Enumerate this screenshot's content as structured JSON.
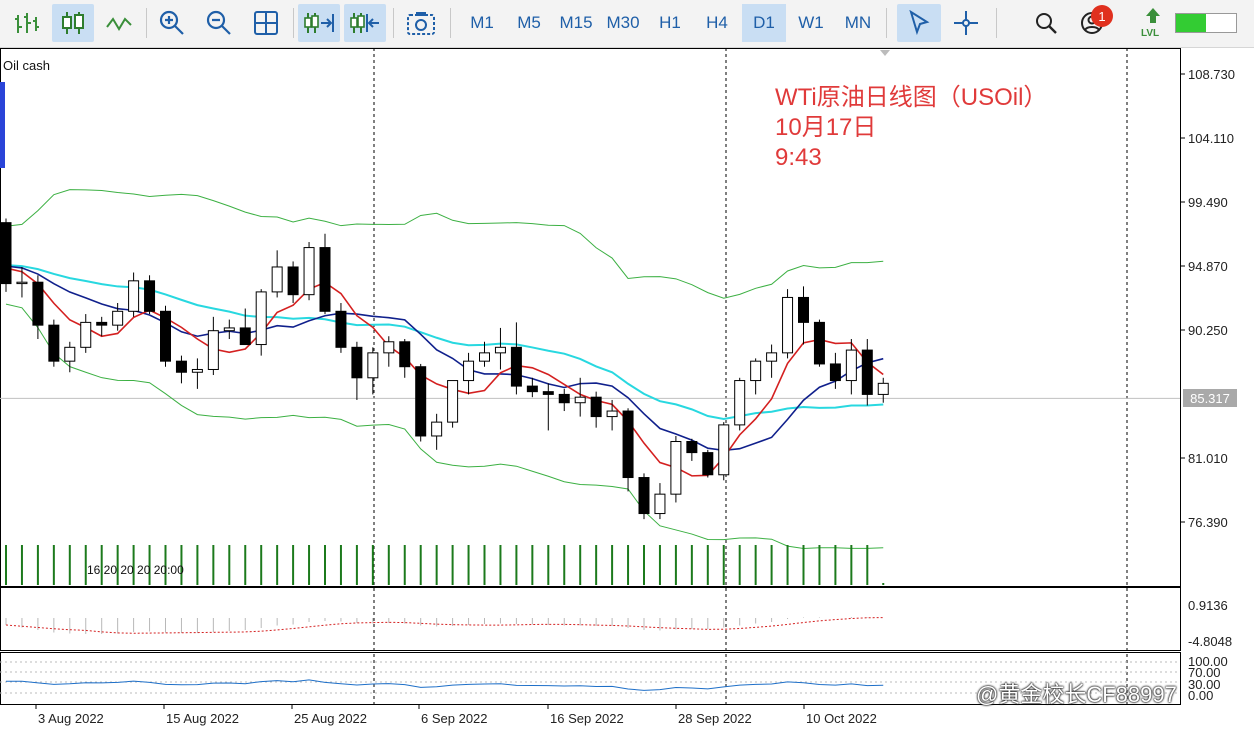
{
  "toolbar": {
    "timeframes": [
      "M1",
      "M5",
      "M15",
      "M30",
      "H1",
      "H4",
      "D1",
      "W1",
      "MN"
    ],
    "active_timeframe": "D1",
    "notification_count": "1",
    "lvl_label": "LVL"
  },
  "chart": {
    "symbol": "Oil cash",
    "annotation": [
      "WTi原油日线图（USOil）",
      "10月17日",
      "9:43"
    ],
    "current_price": "85.317",
    "price_ticks": [
      "108.730",
      "104.110",
      "99.490",
      "94.870",
      "90.250",
      "85.317",
      "81.010",
      "76.390"
    ],
    "macd_ticks": [
      "0.9136",
      "-4.8048"
    ],
    "rsi_ticks": [
      "100.00",
      "70.00",
      "30.00",
      "0.00"
    ],
    "date_labels": [
      "3 Aug 2022",
      "15 Aug 2022",
      "25 Aug 2022",
      "6 Sep 2022",
      "16 Sep 2022",
      "28 Sep 2022",
      "10 Oct 2022"
    ],
    "time_tags": "16 20 20 20 20:00",
    "watermark": "@黄金校长CF88997",
    "colors": {
      "bull": "#ffffff",
      "bear": "#000000",
      "ma_fast": "#d42020",
      "ma_mid": "#10208c",
      "ma_slow": "#28d8e0",
      "bands": "#3cb043",
      "volume": "#1c7a1c",
      "rsi": "#1e6fc8",
      "annotation": "#e03a3a"
    }
  },
  "chart_data": {
    "type": "candlestick",
    "title": "WTi原油日线图（USOil）",
    "x": [
      "1 Aug 2022",
      "2 Aug 2022",
      "3 Aug 2022",
      "4 Aug 2022",
      "5 Aug 2022",
      "8 Aug 2022",
      "9 Aug 2022",
      "10 Aug 2022",
      "11 Aug 2022",
      "12 Aug 2022",
      "15 Aug 2022",
      "16 Aug 2022",
      "17 Aug 2022",
      "18 Aug 2022",
      "19 Aug 2022",
      "22 Aug 2022",
      "23 Aug 2022",
      "24 Aug 2022",
      "25 Aug 2022",
      "26 Aug 2022",
      "29 Aug 2022",
      "30 Aug 2022",
      "31 Aug 2022",
      "1 Sep 2022",
      "2 Sep 2022",
      "5 Sep 2022",
      "6 Sep 2022",
      "7 Sep 2022",
      "8 Sep 2022",
      "9 Sep 2022",
      "12 Sep 2022",
      "13 Sep 2022",
      "14 Sep 2022",
      "15 Sep 2022",
      "16 Sep 2022",
      "19 Sep 2022",
      "20 Sep 2022",
      "21 Sep 2022",
      "22 Sep 2022",
      "23 Sep 2022",
      "26 Sep 2022",
      "27 Sep 2022",
      "28 Sep 2022",
      "29 Sep 2022",
      "30 Sep 2022",
      "3 Oct 2022",
      "4 Oct 2022",
      "5 Oct 2022",
      "6 Oct 2022",
      "7 Oct 2022",
      "10 Oct 2022",
      "11 Oct 2022",
      "12 Oct 2022",
      "13 Oct 2022",
      "14 Oct 2022",
      "17 Oct 2022"
    ],
    "ohlc": [
      [
        98.0,
        98.3,
        93.0,
        93.6
      ],
      [
        93.6,
        94.8,
        92.6,
        93.7
      ],
      [
        93.7,
        94.2,
        89.6,
        90.6
      ],
      [
        90.6,
        91.0,
        87.6,
        88.0
      ],
      [
        88.0,
        89.4,
        87.2,
        89.0
      ],
      [
        89.0,
        91.4,
        88.6,
        90.8
      ],
      [
        90.8,
        91.2,
        89.8,
        90.6
      ],
      [
        90.6,
        92.2,
        90.2,
        91.6
      ],
      [
        91.6,
        94.4,
        91.2,
        93.8
      ],
      [
        93.8,
        94.2,
        91.4,
        91.6
      ],
      [
        91.6,
        92.0,
        87.6,
        88.0
      ],
      [
        88.0,
        88.4,
        86.4,
        87.2
      ],
      [
        87.2,
        88.2,
        86.0,
        87.4
      ],
      [
        87.4,
        91.2,
        87.0,
        90.2
      ],
      [
        90.2,
        91.0,
        89.6,
        90.4
      ],
      [
        90.4,
        91.8,
        89.2,
        89.2
      ],
      [
        89.2,
        93.2,
        88.4,
        93.0
      ],
      [
        93.0,
        96.0,
        92.6,
        94.8
      ],
      [
        94.8,
        95.2,
        92.2,
        92.8
      ],
      [
        92.8,
        96.6,
        92.4,
        96.2
      ],
      [
        96.2,
        97.2,
        91.4,
        91.6
      ],
      [
        91.6,
        92.2,
        88.6,
        89.0
      ],
      [
        89.0,
        89.4,
        85.2,
        86.8
      ],
      [
        86.8,
        89.0,
        85.6,
        88.6
      ],
      [
        88.6,
        89.8,
        87.6,
        89.4
      ],
      [
        89.4,
        89.6,
        86.8,
        87.6
      ],
      [
        87.6,
        87.8,
        82.2,
        82.6
      ],
      [
        82.6,
        84.2,
        81.6,
        83.6
      ],
      [
        83.6,
        86.2,
        83.2,
        86.6
      ],
      [
        86.6,
        88.6,
        85.6,
        88.0
      ],
      [
        88.0,
        89.4,
        87.6,
        88.6
      ],
      [
        88.6,
        90.4,
        87.4,
        89.0
      ],
      [
        89.0,
        90.8,
        85.6,
        86.2
      ],
      [
        86.2,
        86.8,
        85.4,
        85.8
      ],
      [
        85.8,
        86.4,
        83.0,
        85.6
      ],
      [
        85.6,
        86.0,
        84.4,
        85.0
      ],
      [
        85.0,
        86.8,
        84.0,
        85.4
      ],
      [
        85.4,
        85.8,
        83.2,
        84.0
      ],
      [
        84.0,
        85.2,
        83.0,
        84.4
      ],
      [
        84.4,
        84.6,
        78.6,
        79.6
      ],
      [
        79.6,
        79.9,
        76.6,
        77.0
      ],
      [
        77.0,
        79.2,
        76.6,
        78.4
      ],
      [
        78.4,
        82.6,
        77.8,
        82.2
      ],
      [
        82.2,
        82.4,
        80.8,
        81.4
      ],
      [
        81.4,
        81.6,
        79.6,
        79.8
      ],
      [
        79.8,
        83.6,
        79.4,
        83.4
      ],
      [
        83.4,
        86.8,
        83.0,
        86.6
      ],
      [
        86.6,
        88.2,
        85.6,
        88.0
      ],
      [
        88.0,
        89.2,
        86.8,
        88.6
      ],
      [
        88.6,
        93.2,
        88.2,
        92.6
      ],
      [
        92.6,
        93.4,
        89.2,
        90.8
      ],
      [
        90.8,
        91.0,
        87.6,
        87.8
      ],
      [
        87.8,
        88.6,
        86.0,
        86.6
      ],
      [
        86.6,
        89.6,
        85.6,
        88.8
      ],
      [
        88.8,
        89.6,
        84.8,
        85.6
      ],
      [
        85.6,
        86.8,
        85.0,
        86.4
      ]
    ],
    "volume": [
      100,
      100,
      100,
      100,
      100,
      100,
      100,
      100,
      100,
      100,
      100,
      100,
      100,
      100,
      100,
      100,
      100,
      100,
      100,
      100,
      100,
      100,
      100,
      100,
      100,
      100,
      100,
      100,
      100,
      100,
      100,
      100,
      100,
      100,
      100,
      100,
      100,
      100,
      100,
      100,
      100,
      100,
      100,
      100,
      100,
      100,
      100,
      100,
      100,
      100,
      100,
      100,
      100,
      100,
      100,
      5
    ],
    "macd": [
      -1.4,
      -1.9,
      -2.4,
      -2.9,
      -3.1,
      -3.2,
      -3.2,
      -3.1,
      -2.8,
      -2.7,
      -2.9,
      -3.0,
      -3.0,
      -2.8,
      -2.6,
      -2.4,
      -2.0,
      -1.5,
      -1.3,
      -0.8,
      -0.6,
      -0.7,
      -1.0,
      -1.1,
      -1.0,
      -1.1,
      -1.5,
      -1.7,
      -1.6,
      -1.4,
      -1.2,
      -1.1,
      -1.2,
      -1.3,
      -1.4,
      -1.5,
      -1.5,
      -1.6,
      -1.6,
      -2.0,
      -2.4,
      -2.5,
      -2.3,
      -2.2,
      -2.2,
      -1.9,
      -1.5,
      -1.1,
      -0.8,
      -0.2,
      0.1,
      0.1,
      0.0,
      0.2,
      0.1,
      0.0
    ],
    "ylim": [
      74.0,
      110.0
    ]
  }
}
